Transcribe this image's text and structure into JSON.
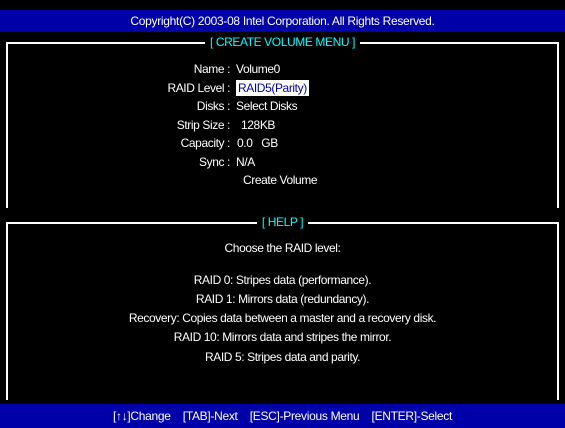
{
  "header": {
    "copyright": "Copyright(C) 2003-08 Intel Corporation.  All Rights Reserved."
  },
  "create_menu": {
    "title": "[ CREATE VOLUME MENU ]",
    "fields": [
      {
        "label": "Name :",
        "value": "Volume0"
      },
      {
        "label": "RAID Level :",
        "value": "RAID5(Parity)"
      },
      {
        "label": "Disks :",
        "value": "Select Disks"
      },
      {
        "label": "Strip Size :",
        "value": "128KB"
      },
      {
        "label": "Capacity :",
        "value": "0.0   GB"
      },
      {
        "label": "Sync :",
        "value": "N/A"
      }
    ],
    "create_action": "Create Volume"
  },
  "help": {
    "title": "[ HELP ]",
    "heading": "Choose the RAID level:",
    "lines": [
      "RAID 0:  Stripes data (performance).",
      "RAID 1:  Mirrors data (redundancy).",
      "Recovery:  Copies data between a master and a recovery disk.",
      "RAID 10:  Mirrors data and stripes the mirror.",
      "RAID 5:  Stripes data and parity."
    ]
  },
  "footer": {
    "nav_keys": "[↑↓]Change    [TAB]-Next    [ESC]-Previous Menu    [ENTER]-Select"
  },
  "colors": {
    "bar_background": "#0000a8",
    "panel_background": "#000000",
    "title_accent": "#00ffff",
    "text": "#ffffff"
  }
}
